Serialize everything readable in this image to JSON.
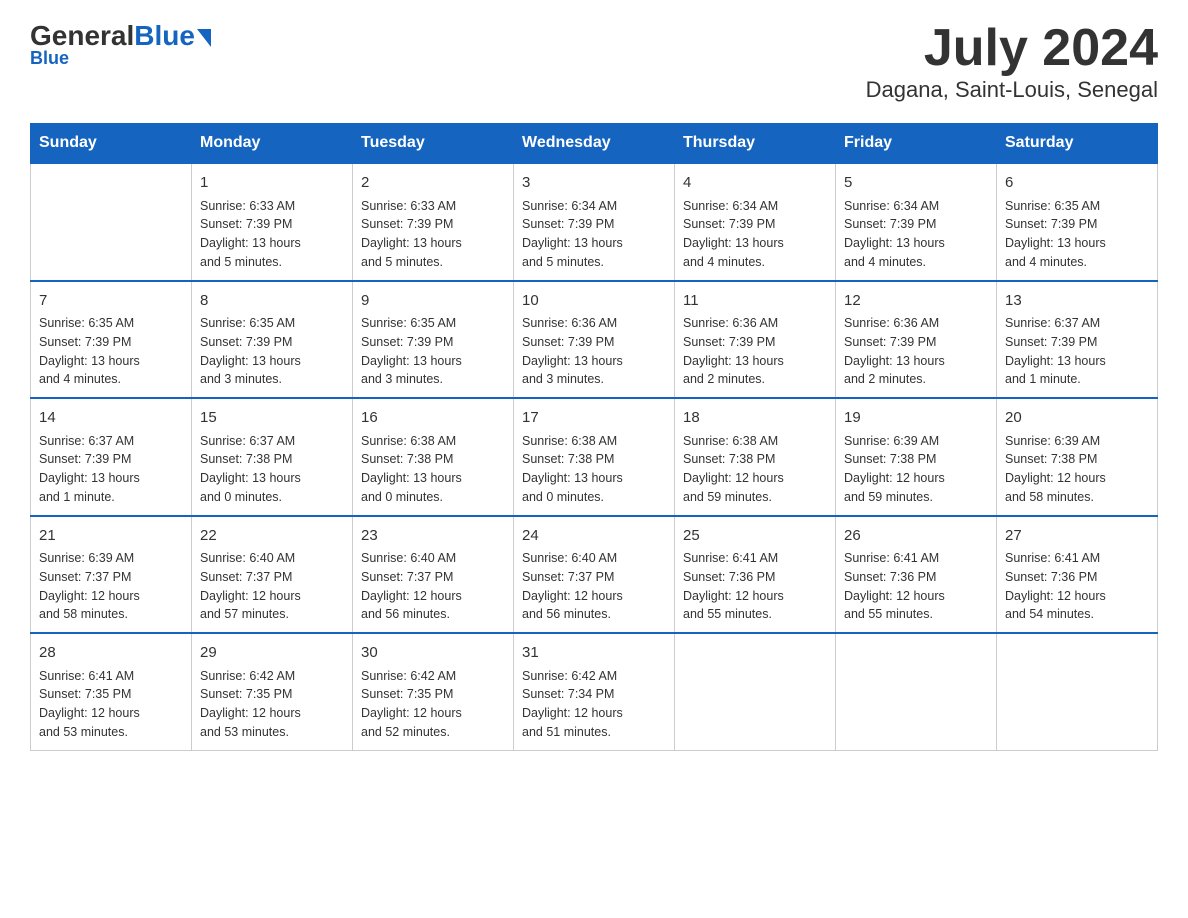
{
  "logo": {
    "general": "General",
    "blue": "Blue"
  },
  "title": "July 2024",
  "subtitle": "Dagana, Saint-Louis, Senegal",
  "days_of_week": [
    "Sunday",
    "Monday",
    "Tuesday",
    "Wednesday",
    "Thursday",
    "Friday",
    "Saturday"
  ],
  "weeks": [
    [
      {
        "day": "",
        "info": ""
      },
      {
        "day": "1",
        "info": "Sunrise: 6:33 AM\nSunset: 7:39 PM\nDaylight: 13 hours\nand 5 minutes."
      },
      {
        "day": "2",
        "info": "Sunrise: 6:33 AM\nSunset: 7:39 PM\nDaylight: 13 hours\nand 5 minutes."
      },
      {
        "day": "3",
        "info": "Sunrise: 6:34 AM\nSunset: 7:39 PM\nDaylight: 13 hours\nand 5 minutes."
      },
      {
        "day": "4",
        "info": "Sunrise: 6:34 AM\nSunset: 7:39 PM\nDaylight: 13 hours\nand 4 minutes."
      },
      {
        "day": "5",
        "info": "Sunrise: 6:34 AM\nSunset: 7:39 PM\nDaylight: 13 hours\nand 4 minutes."
      },
      {
        "day": "6",
        "info": "Sunrise: 6:35 AM\nSunset: 7:39 PM\nDaylight: 13 hours\nand 4 minutes."
      }
    ],
    [
      {
        "day": "7",
        "info": "Sunrise: 6:35 AM\nSunset: 7:39 PM\nDaylight: 13 hours\nand 4 minutes."
      },
      {
        "day": "8",
        "info": "Sunrise: 6:35 AM\nSunset: 7:39 PM\nDaylight: 13 hours\nand 3 minutes."
      },
      {
        "day": "9",
        "info": "Sunrise: 6:35 AM\nSunset: 7:39 PM\nDaylight: 13 hours\nand 3 minutes."
      },
      {
        "day": "10",
        "info": "Sunrise: 6:36 AM\nSunset: 7:39 PM\nDaylight: 13 hours\nand 3 minutes."
      },
      {
        "day": "11",
        "info": "Sunrise: 6:36 AM\nSunset: 7:39 PM\nDaylight: 13 hours\nand 2 minutes."
      },
      {
        "day": "12",
        "info": "Sunrise: 6:36 AM\nSunset: 7:39 PM\nDaylight: 13 hours\nand 2 minutes."
      },
      {
        "day": "13",
        "info": "Sunrise: 6:37 AM\nSunset: 7:39 PM\nDaylight: 13 hours\nand 1 minute."
      }
    ],
    [
      {
        "day": "14",
        "info": "Sunrise: 6:37 AM\nSunset: 7:39 PM\nDaylight: 13 hours\nand 1 minute."
      },
      {
        "day": "15",
        "info": "Sunrise: 6:37 AM\nSunset: 7:38 PM\nDaylight: 13 hours\nand 0 minutes."
      },
      {
        "day": "16",
        "info": "Sunrise: 6:38 AM\nSunset: 7:38 PM\nDaylight: 13 hours\nand 0 minutes."
      },
      {
        "day": "17",
        "info": "Sunrise: 6:38 AM\nSunset: 7:38 PM\nDaylight: 13 hours\nand 0 minutes."
      },
      {
        "day": "18",
        "info": "Sunrise: 6:38 AM\nSunset: 7:38 PM\nDaylight: 12 hours\nand 59 minutes."
      },
      {
        "day": "19",
        "info": "Sunrise: 6:39 AM\nSunset: 7:38 PM\nDaylight: 12 hours\nand 59 minutes."
      },
      {
        "day": "20",
        "info": "Sunrise: 6:39 AM\nSunset: 7:38 PM\nDaylight: 12 hours\nand 58 minutes."
      }
    ],
    [
      {
        "day": "21",
        "info": "Sunrise: 6:39 AM\nSunset: 7:37 PM\nDaylight: 12 hours\nand 58 minutes."
      },
      {
        "day": "22",
        "info": "Sunrise: 6:40 AM\nSunset: 7:37 PM\nDaylight: 12 hours\nand 57 minutes."
      },
      {
        "day": "23",
        "info": "Sunrise: 6:40 AM\nSunset: 7:37 PM\nDaylight: 12 hours\nand 56 minutes."
      },
      {
        "day": "24",
        "info": "Sunrise: 6:40 AM\nSunset: 7:37 PM\nDaylight: 12 hours\nand 56 minutes."
      },
      {
        "day": "25",
        "info": "Sunrise: 6:41 AM\nSunset: 7:36 PM\nDaylight: 12 hours\nand 55 minutes."
      },
      {
        "day": "26",
        "info": "Sunrise: 6:41 AM\nSunset: 7:36 PM\nDaylight: 12 hours\nand 55 minutes."
      },
      {
        "day": "27",
        "info": "Sunrise: 6:41 AM\nSunset: 7:36 PM\nDaylight: 12 hours\nand 54 minutes."
      }
    ],
    [
      {
        "day": "28",
        "info": "Sunrise: 6:41 AM\nSunset: 7:35 PM\nDaylight: 12 hours\nand 53 minutes."
      },
      {
        "day": "29",
        "info": "Sunrise: 6:42 AM\nSunset: 7:35 PM\nDaylight: 12 hours\nand 53 minutes."
      },
      {
        "day": "30",
        "info": "Sunrise: 6:42 AM\nSunset: 7:35 PM\nDaylight: 12 hours\nand 52 minutes."
      },
      {
        "day": "31",
        "info": "Sunrise: 6:42 AM\nSunset: 7:34 PM\nDaylight: 12 hours\nand 51 minutes."
      },
      {
        "day": "",
        "info": ""
      },
      {
        "day": "",
        "info": ""
      },
      {
        "day": "",
        "info": ""
      }
    ]
  ]
}
